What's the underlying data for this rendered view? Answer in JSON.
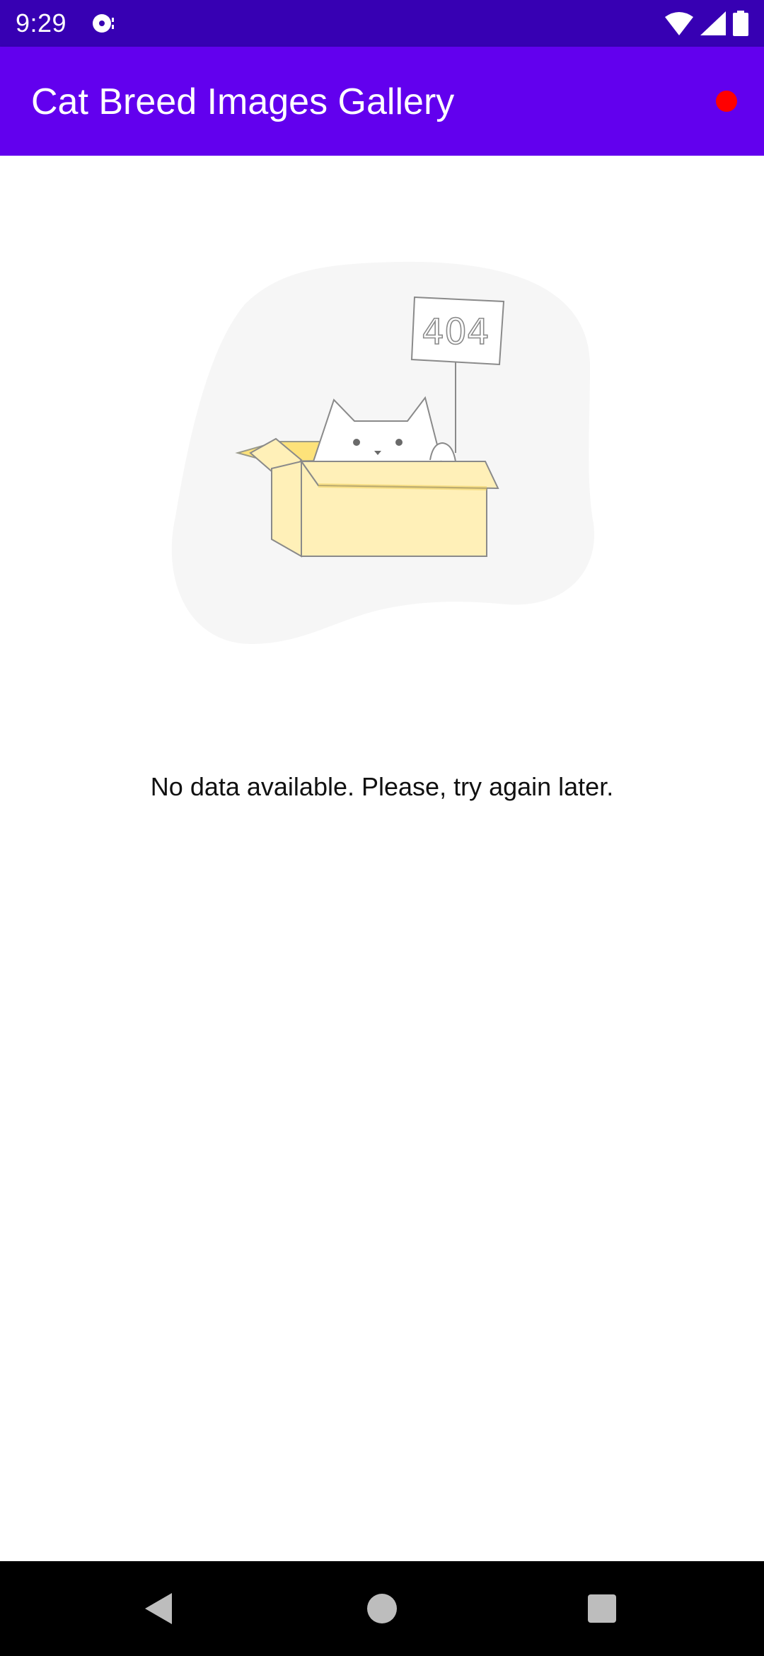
{
  "status_bar": {
    "time": "9:29",
    "icons": [
      "notification-icon",
      "wifi-icon",
      "signal-icon",
      "battery-icon"
    ]
  },
  "app_bar": {
    "title": "Cat Breed Images Gallery",
    "indicator_color": "#ff0000"
  },
  "empty_state": {
    "sign_text": "404",
    "message": "No data available. Please, try again later."
  },
  "nav_bar": {
    "buttons": [
      "back-icon",
      "home-icon",
      "recents-icon"
    ]
  },
  "colors": {
    "status_bar": "#3700b3",
    "app_bar": "#6200ee",
    "background": "#ffffff",
    "nav_bar": "#000000"
  }
}
